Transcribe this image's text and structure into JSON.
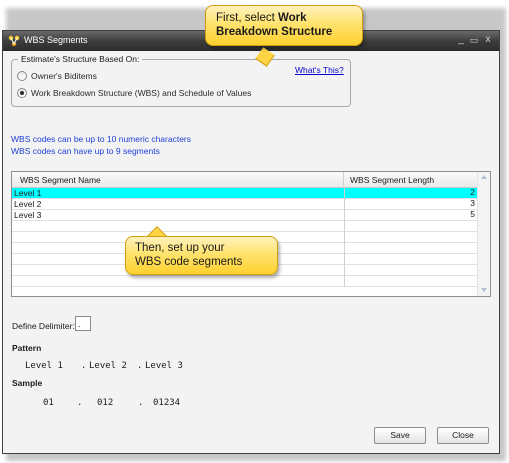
{
  "window": {
    "title": "WBS Segments",
    "controls": {
      "minimize": "_",
      "maximize": "▭",
      "close": "x"
    }
  },
  "structure_group": {
    "legend": "Estimate's Structure Based On:",
    "options": [
      {
        "label": "Owner's Biditems",
        "selected": false
      },
      {
        "label": "Work Breakdown Structure (WBS) and Schedule of Values",
        "selected": true
      }
    ],
    "help_link": "What's This?"
  },
  "info": {
    "line1": "WBS codes can be up to 10 numeric characters",
    "line2": "WBS codes can have up to 9 segments"
  },
  "grid": {
    "columns": [
      "WBS Segment Name",
      "WBS Segment Length"
    ],
    "rows": [
      {
        "name": "Level 1",
        "length": "2",
        "selected": true
      },
      {
        "name": "Level 2",
        "length": "3",
        "selected": false
      },
      {
        "name": "Level 3",
        "length": "5",
        "selected": false
      }
    ]
  },
  "delimiter": {
    "label": "Define Delimiter:",
    "value": "."
  },
  "pattern": {
    "label": "Pattern",
    "segments": [
      "Level 1",
      "Level 2",
      "Level 3"
    ],
    "separator": "."
  },
  "sample": {
    "label": "Sample",
    "segments": [
      "01",
      "012",
      "01234"
    ],
    "separator": "."
  },
  "buttons": {
    "save": "Save",
    "close": "Close"
  },
  "callouts": {
    "first_prefix": "First, select ",
    "first_bold": "Work Breakdown Structure",
    "second_line1": "Then, set up your",
    "second_line2": "WBS code segments"
  },
  "colors": {
    "selected_row": "#00ffff",
    "info_text": "#1f3fd8",
    "link": "#0000cc",
    "callout_fill": "#ffe36f",
    "callout_border": "#d39d12",
    "titlebar": "#3c3c3c"
  }
}
